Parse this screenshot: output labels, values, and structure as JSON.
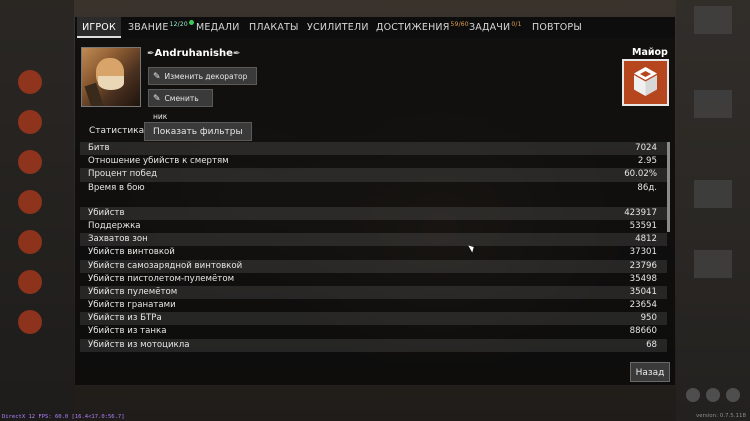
{
  "tabs": [
    {
      "label": "ИГРОК",
      "active": true
    },
    {
      "label": "ЗВАНИЕ",
      "badge": "12/20",
      "badge_color": "#99eecc",
      "dot": true
    },
    {
      "label": "МЕДАЛИ"
    },
    {
      "label": "ПЛАКАТЫ"
    },
    {
      "label": "УСИЛИТЕЛИ"
    },
    {
      "label": "ДОСТИЖЕНИЯ",
      "badge": "59/60",
      "badge_color": "#e0a050"
    },
    {
      "label": "ЗАДАЧИ",
      "badge": "0/1",
      "badge_color": "#e0a050"
    },
    {
      "label": "ПОВТОРЫ"
    }
  ],
  "profile": {
    "nickname": "Andruhanishe",
    "decorator_button": "Изменить декоратор имени",
    "change_nick_button": "Сменить ник",
    "rank_name": "Майор",
    "rank_color": "#b5461e"
  },
  "stats_tabs": {
    "stats_label": "Статистика",
    "filters_button": "Показать фильтры"
  },
  "stats": {
    "group1": [
      {
        "label": "Битв",
        "value": "7024"
      },
      {
        "label": "Отношение убийств к смертям",
        "value": "2.95"
      },
      {
        "label": "Процент побед",
        "value": "60.02%"
      },
      {
        "label": "Время в бою",
        "value": "86д."
      }
    ],
    "group2": [
      {
        "label": "Убийств",
        "value": "423917"
      },
      {
        "label": "Поддержка",
        "value": "53591"
      },
      {
        "label": "Захватов зон",
        "value": "4812"
      },
      {
        "label": "Убийств винтовкой",
        "value": "37301"
      },
      {
        "label": "Убийств самозарядной винтовкой",
        "value": "23796"
      },
      {
        "label": "Убийств пистолетом-пулемётом",
        "value": "35498"
      },
      {
        "label": "Убийств пулемётом",
        "value": "35041"
      },
      {
        "label": "Убийств гранатами",
        "value": "23654"
      },
      {
        "label": "Убийств из БТРа",
        "value": "950"
      },
      {
        "label": "Убийств из танка",
        "value": "88660"
      },
      {
        "label": "Убийств из мотоцикла",
        "value": "68"
      }
    ]
  },
  "back_button": "Назад",
  "fps_text": "DirectX 12 FPS: 60.0 [16.4<17.0:56.7]",
  "version_text": "version: 0.7.5.118"
}
